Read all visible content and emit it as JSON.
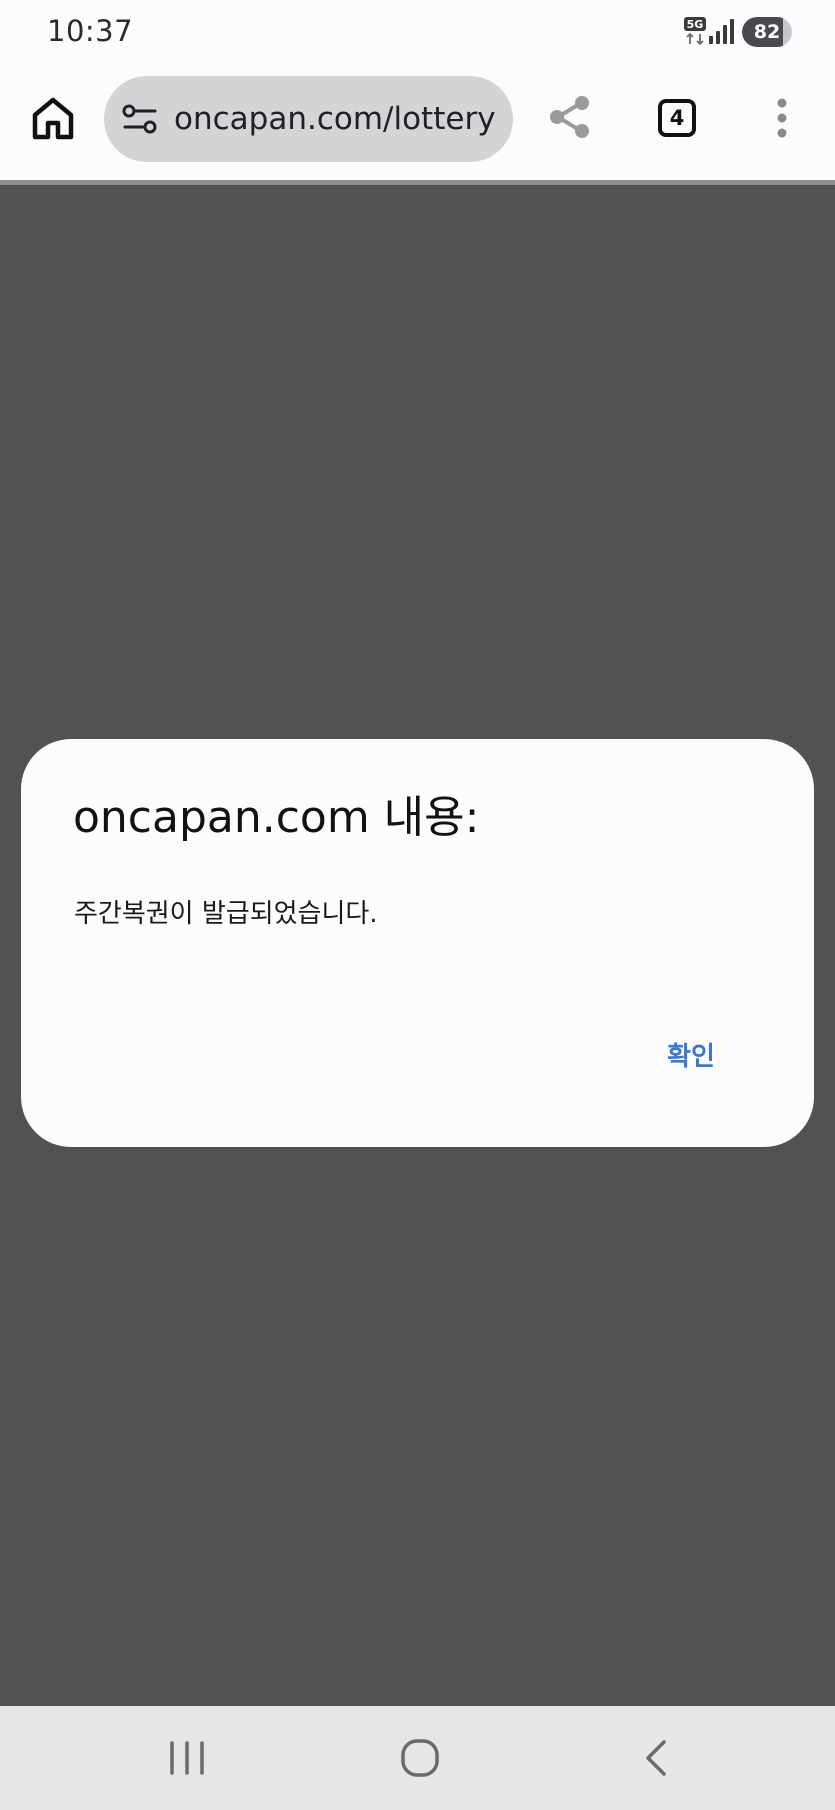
{
  "status_bar": {
    "time": "10:37",
    "network_label": "5G",
    "battery_percent": "82",
    "battery_level": 0.82
  },
  "toolbar": {
    "url": "oncapan.com/lottery",
    "open_tabs": "4",
    "icons": {
      "home": "home-icon",
      "site_settings": "tune-icon",
      "share": "share-icon",
      "menu": "more-vert-icon"
    }
  },
  "dialog": {
    "title": "oncapan.com 내용:",
    "message": "주간복권이 발급되었습니다.",
    "confirm_label": "확인"
  },
  "nav_bar": {
    "icons": {
      "recents": "recents-icon",
      "home": "home-circle-icon",
      "back": "back-chevron-icon"
    }
  },
  "colors": {
    "accent": "#3b78d0",
    "overlay": "#525252",
    "url_bar": "#d4d4d7",
    "nav_bar": "#e6e6e8"
  }
}
